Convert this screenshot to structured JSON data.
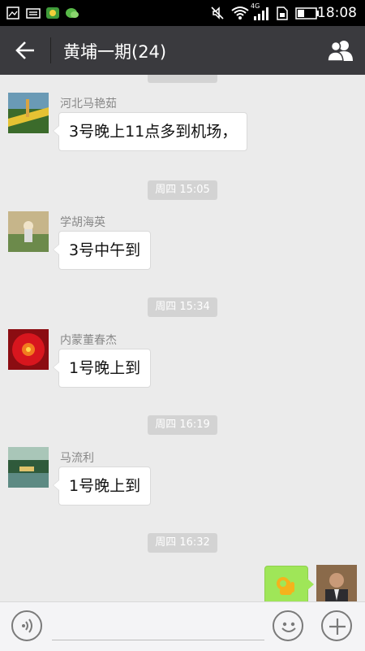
{
  "status_bar": {
    "time": "18:08",
    "network": "4G"
  },
  "header": {
    "title": "黄埔一期(24)",
    "back_icon": "arrow-left-icon",
    "members_icon": "group-members-icon"
  },
  "messages": [
    {
      "sender": "河北马艳茹",
      "text": "3号晚上11点多到机场，"
    },
    {
      "timestamp": "周四 15:05",
      "sender": "学胡海英",
      "text": "3号中午到"
    },
    {
      "timestamp": "周四 15:34",
      "sender": "内蒙董春杰",
      "text": "1号晚上到"
    },
    {
      "timestamp": "周四 16:19",
      "sender": "马流利",
      "text": "1号晚上到"
    },
    {
      "timestamp": "周四 16:32"
    }
  ],
  "outgoing": {
    "emoji": "ok-hand-emoji"
  },
  "input_bar": {
    "voice_icon": "voice-icon",
    "emoji_icon": "smiley-icon",
    "add_icon": "plus-icon"
  },
  "colors": {
    "title_bar": "#3a3a3e",
    "chat_bg": "#ebebeb",
    "outgoing_bubble": "#9fe658",
    "timestamp_bg": "#d3d3d3"
  }
}
